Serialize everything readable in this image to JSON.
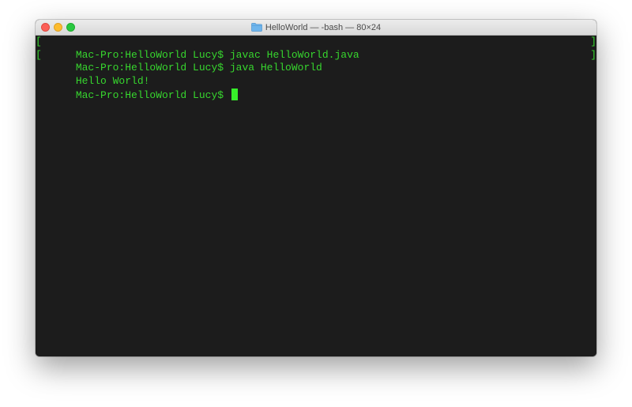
{
  "window": {
    "title": "HelloWorld — -bash — 80×24",
    "folder_icon": "folder-icon"
  },
  "terminal": {
    "lines": [
      {
        "text": "Mac-Pro:HelloWorld Lucy$ javac HelloWorld.java",
        "marked": true
      },
      {
        "text": "Mac-Pro:HelloWorld Lucy$ java HelloWorld",
        "marked": true
      },
      {
        "text": "Hello World!",
        "marked": false
      },
      {
        "text": "Mac-Pro:HelloWorld Lucy$ ",
        "marked": false
      }
    ],
    "colors": {
      "background": "#1c1c1c",
      "foreground": "#37d62e",
      "cursor": "#37f02a"
    }
  }
}
